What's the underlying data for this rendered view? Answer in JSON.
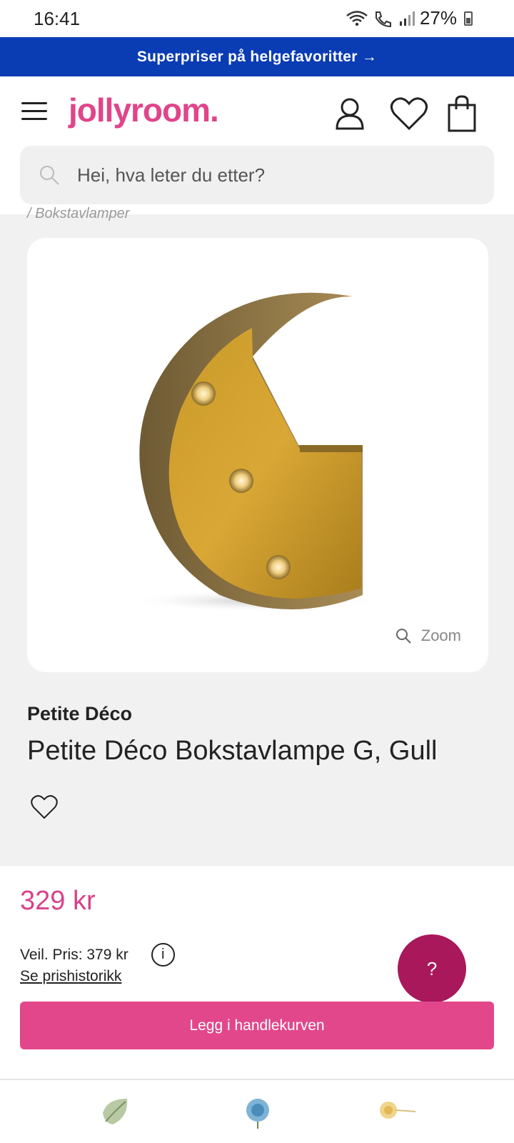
{
  "status_bar": {
    "time": "16:41",
    "battery": "27%"
  },
  "promo": {
    "text": "Superpriser på helgefavoritter →"
  },
  "header": {
    "logo": "jollyroom."
  },
  "search": {
    "placeholder": "Hei, hva leter du etter?"
  },
  "breadcrumb": {
    "text": "/  Bokstavlamper"
  },
  "product": {
    "zoom_label": "Zoom",
    "brand": "Petite Déco",
    "title": "Petite Déco Bokstavlampe G, Gull",
    "price": "329 kr",
    "rrp": "Veil. Pris: 379 kr",
    "info_icon": "i",
    "price_history_link": "Se prishistorikk",
    "add_to_cart": "Legg i handlekurven"
  },
  "help": {
    "label": "?"
  },
  "colors": {
    "brand_pink": "#e2478b",
    "promo_blue": "#0a3cb4",
    "help_purple": "#a8185a",
    "price_pink": "#d8428a"
  },
  "icons": [
    "wifi-icon",
    "call-icon",
    "signal-icon",
    "battery-icon",
    "menu-icon",
    "account-icon",
    "heart-icon",
    "bag-icon",
    "search-icon",
    "zoom-icon",
    "wishlist-heart-icon",
    "info-icon",
    "leaf-icon",
    "blue-flower-icon",
    "yellow-flower-icon"
  ]
}
